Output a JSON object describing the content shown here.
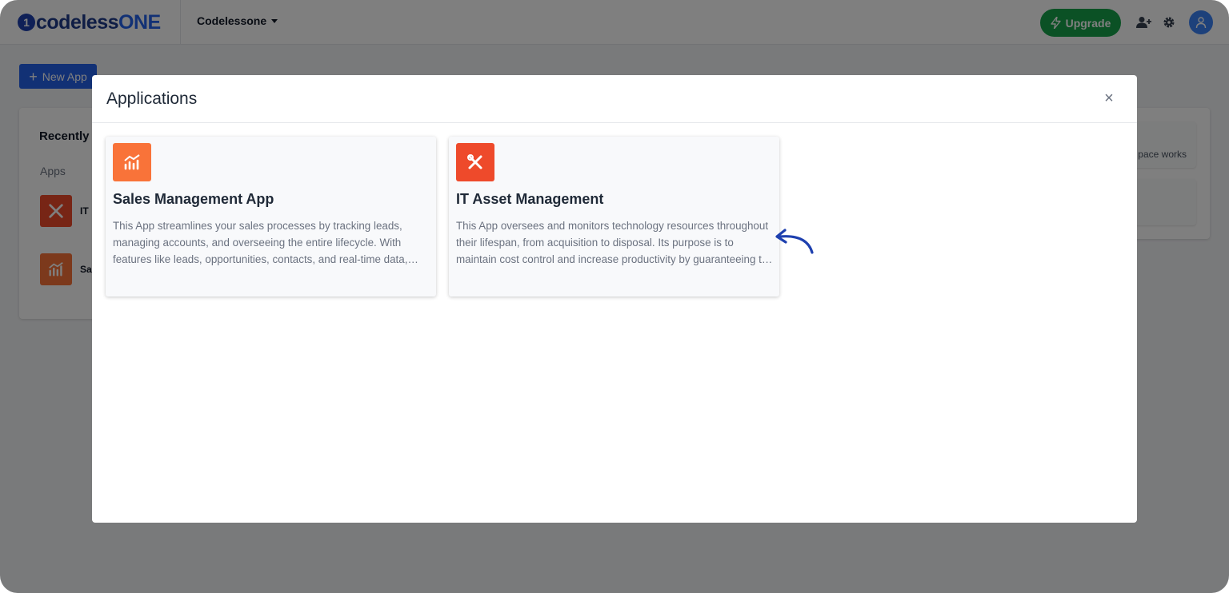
{
  "header": {
    "logo_mark": "1",
    "logo_text_main": "codeless",
    "logo_text_accent": "ONE",
    "workspace": "Codelessone",
    "upgrade_label": "Upgrade",
    "icons": [
      "add-user-icon",
      "gear-icon",
      "user-icon"
    ]
  },
  "page": {
    "new_app_label": "New App",
    "recent_title": "Recently",
    "recent_sub": "Apps",
    "recent_items": [
      {
        "label": "IT",
        "icon": "tools-icon"
      },
      {
        "label": "Sa",
        "icon": "chart-icon"
      }
    ],
    "right_panel_text": "pace works"
  },
  "modal": {
    "title": "Applications",
    "close_label": "×",
    "apps": [
      {
        "name": "Sales Management App",
        "description": "This App streamlines your sales processes by tracking leads, managing accounts, and overseeing the entire lifecycle. With features like leads, opportunities, contacts, and real-time data, you…",
        "icon": "chart-icon",
        "icon_color": "#f97339"
      },
      {
        "name": "IT Asset Management",
        "description": "This App oversees and monitors technology resources throughout their lifespan, from acquisition to disposal. Its purpose is to maintain cost control and increase productivity by guaranteeing the efficien…",
        "icon": "tools-icon",
        "icon_color": "#ee4a2b"
      }
    ]
  },
  "colors": {
    "primary": "#2563eb",
    "upgrade": "#16a34a",
    "arrow": "#1e40af"
  }
}
